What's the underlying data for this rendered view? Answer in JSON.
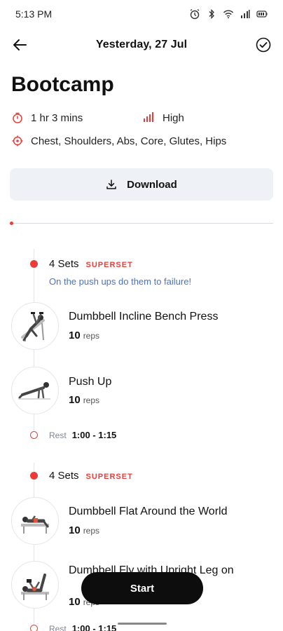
{
  "status_bar": {
    "time": "5:13 PM",
    "icons": [
      "alarm-icon",
      "bluetooth-icon",
      "wifi-icon",
      "signal-icon",
      "battery-icon"
    ]
  },
  "header": {
    "title": "Yesterday, 27 Jul",
    "back_icon": "arrow-left-icon",
    "done_icon": "check-circle-icon"
  },
  "workout": {
    "title": "Bootcamp",
    "duration": "1 hr 3 mins",
    "intensity": "High",
    "muscles": "Chest, Shoulders, Abs, Core, Glutes, Hips"
  },
  "download": {
    "label": "Download",
    "icon": "download-icon"
  },
  "colors": {
    "accent": "#ee3b36",
    "note": "#4a72c2",
    "button_bg": "#eef1f5",
    "start_bg": "#0d0d0d"
  },
  "blocks": [
    {
      "sets": "4 Sets",
      "tag": "SUPERSET",
      "note": "On the push ups do them to failure!",
      "exercises": [
        {
          "name": "Dumbbell Incline Bench Press",
          "reps": "10",
          "unit": "reps"
        },
        {
          "name": "Push Up",
          "reps": "10",
          "unit": "reps"
        }
      ],
      "rest_label": "Rest",
      "rest_value": "1:00 - 1:15"
    },
    {
      "sets": "4 Sets",
      "tag": "SUPERSET",
      "exercises": [
        {
          "name": "Dumbbell Flat Around the World",
          "reps": "10",
          "unit": "reps"
        },
        {
          "name": "Dumbbell Fly with Upright Leg on",
          "reps": "10",
          "unit": "reps"
        }
      ],
      "rest_label": "Rest",
      "rest_value": "1:00 - 1:15"
    }
  ],
  "start_button": {
    "label": "Start"
  }
}
